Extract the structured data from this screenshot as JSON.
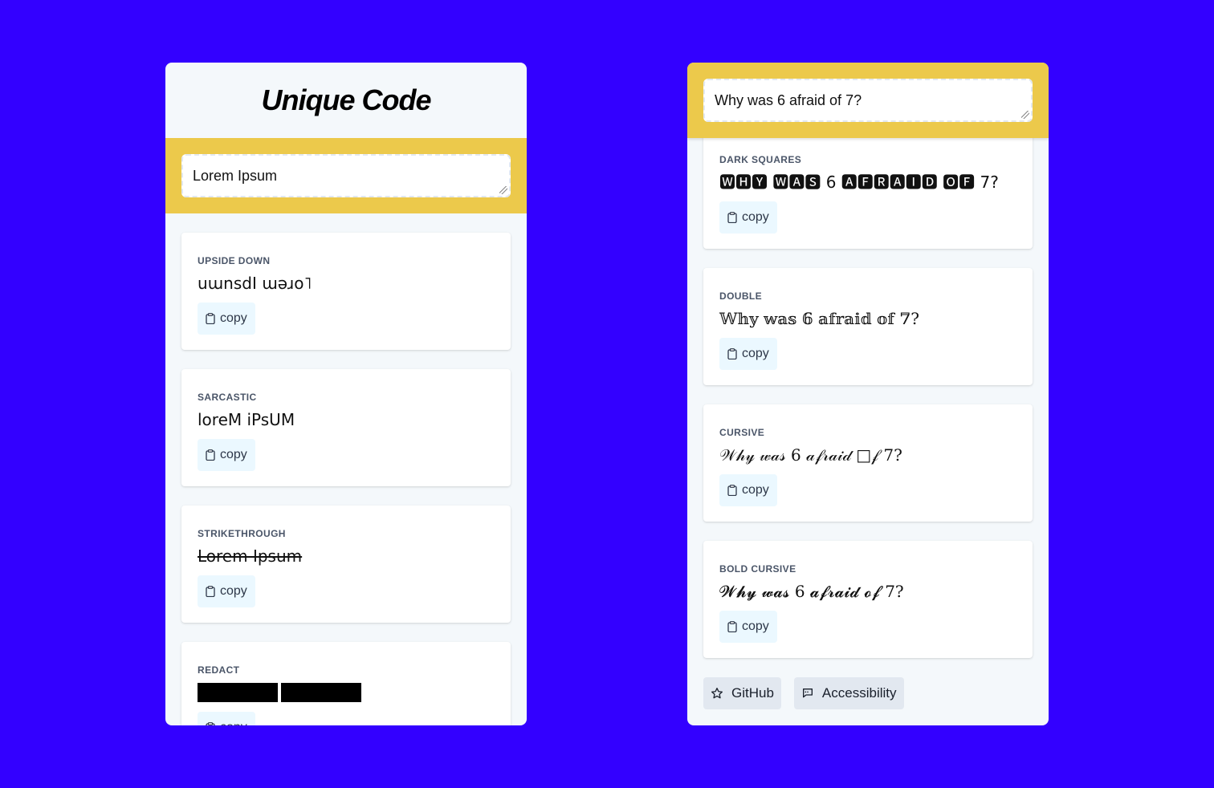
{
  "left_panel": {
    "title": "Unique Code",
    "input_value": "Lorem Ipsum",
    "cards": [
      {
        "label": "UPSIDE DOWN",
        "value": "uɯnsdI ɯǝɹo˥",
        "copy_label": "copy"
      },
      {
        "label": "SARCASTIC",
        "value": "loreM iPsUM",
        "copy_label": "copy"
      },
      {
        "label": "STRIKETHROUGH",
        "value": "Lorem Ipsum",
        "copy_label": "copy"
      },
      {
        "label": "REDACT",
        "value_redacted": "Lorem Ipsum",
        "copy_label": "copy"
      }
    ]
  },
  "right_panel": {
    "input_value": "Why was 6 afraid of 7?",
    "cards": [
      {
        "label": "DARK SQUARES",
        "value": "🆆🅷🆈 🆆🅰🆂 6 🅰🅵🆁🅰🅸🅳 🅾🅵 7?",
        "copy_label": "copy"
      },
      {
        "label": "DOUBLE",
        "value": "𝕎𝕙𝕪 𝕨𝕒𝕤 𝟞 𝕒𝕗𝕣𝕒𝕚𝕕 𝕠𝕗 𝟟?",
        "copy_label": "copy"
      },
      {
        "label": "CURSIVE",
        "value": "𝒲𝒽𝓎 𝓌𝒶𝓈 6 𝒶𝒻𝓇𝒶𝒾𝒹 □𝒻 7?",
        "copy_label": "copy"
      },
      {
        "label": "BOLD CURSIVE",
        "value": "𝓦𝓱𝔂 𝔀𝓪𝓼 6 𝓪𝓯𝓻𝓪𝓲𝓭 𝓸𝓯 7?",
        "copy_label": "copy"
      }
    ],
    "footer": {
      "github_label": "GitHub",
      "accessibility_label": "Accessibility"
    }
  },
  "icons": {
    "copy": "clipboard-icon",
    "github": "star-icon",
    "accessibility": "speech-bubble-icon"
  },
  "colors": {
    "background": "#3300ff",
    "panel": "#f4f8fb",
    "input_band": "#ecc94b",
    "copy_button": "#ebf8ff",
    "footer_button": "#e2e8f0"
  }
}
